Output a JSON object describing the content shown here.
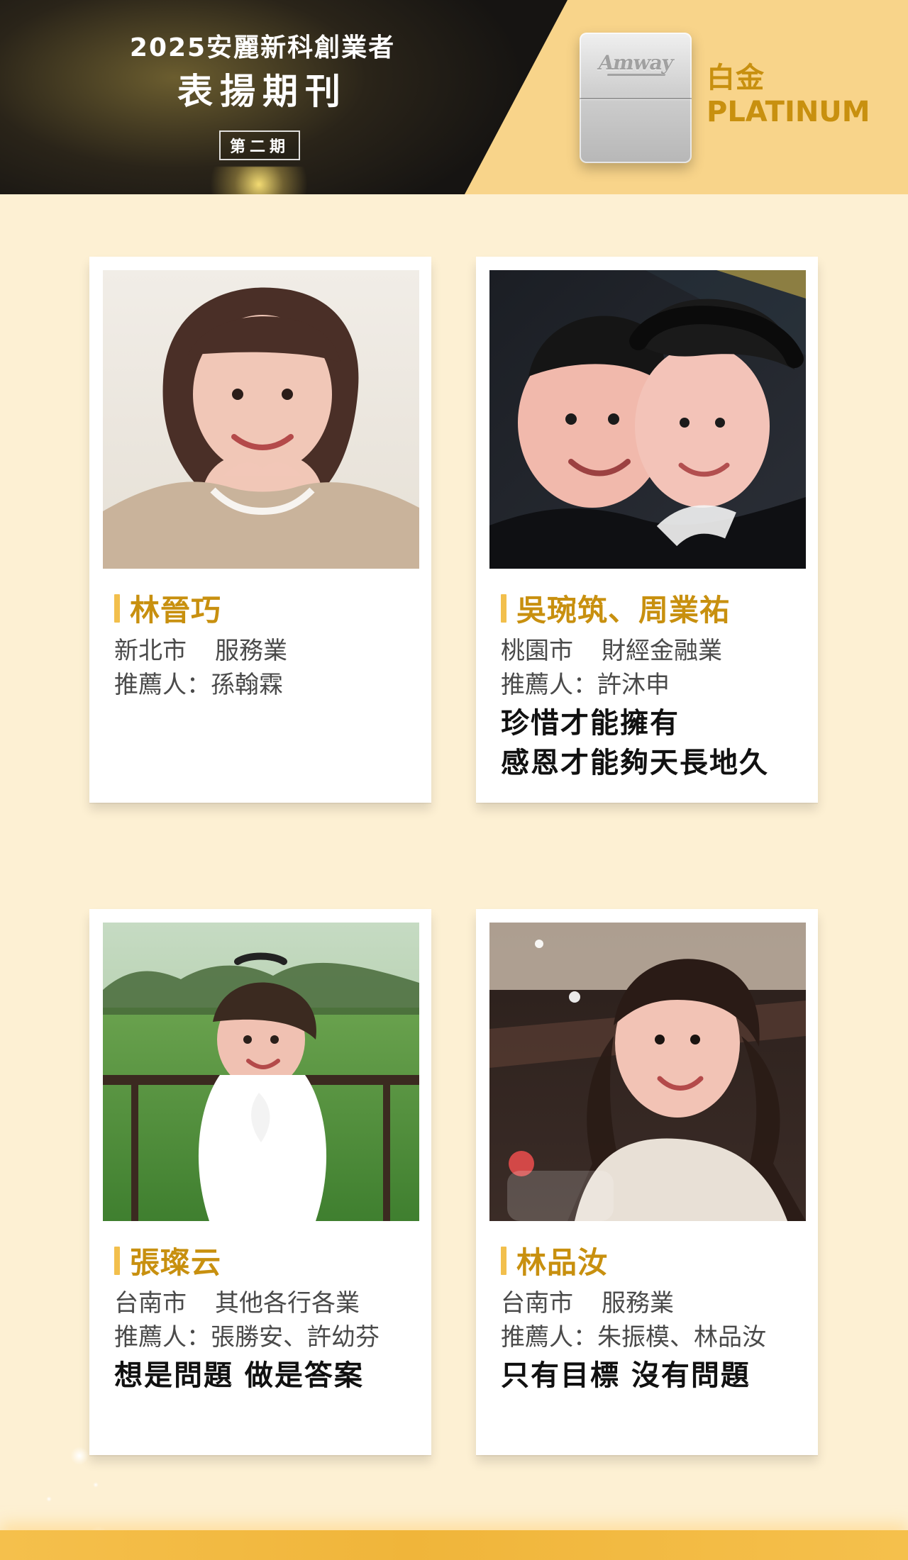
{
  "header": {
    "line1": "2025安麗新科創業者",
    "line2": "表揚期刊",
    "issue": "第二期",
    "rank_cn": "白金",
    "rank_en": "PLATINUM",
    "badge_logo": "Amway",
    "colors": {
      "gold": "#c8900f",
      "accent": "#f2bf4c",
      "background": "#fdf0d3"
    }
  },
  "cards": [
    {
      "name": "林晉巧",
      "city": "新北市",
      "industry": "服務業",
      "recommender": "推薦人：孫翰霖",
      "quote": ""
    },
    {
      "name": "吳琬筑、周業祐",
      "city": "桃園市",
      "industry": "財經金融業",
      "recommender": "推薦人：許沐申",
      "quote": "珍惜才能擁有\n感恩才能夠天長地久"
    },
    {
      "name": "張璨云",
      "city": "台南市",
      "industry": "其他各行各業",
      "recommender": "推薦人：張勝安、許幼芬",
      "quote": "想是問題  做是答案"
    },
    {
      "name": "林品汝",
      "city": "台南市",
      "industry": "服務業",
      "recommender": "推薦人：朱振模、林品汝",
      "quote": "只有目標  沒有問題"
    }
  ]
}
